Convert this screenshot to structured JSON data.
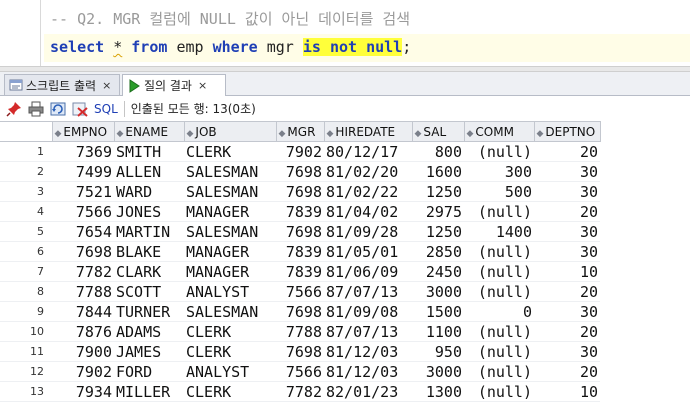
{
  "editor": {
    "comment": "-- Q2. MGR 컬럼에 NULL 값이 아닌 데이터를 검색",
    "sql": {
      "kw_select": "select",
      "star": "*",
      "kw_from": "from",
      "table": "emp",
      "kw_where": "where",
      "column": "mgr",
      "kw_is": "is",
      "kw_not": "not",
      "kw_null": "null",
      "terminator": ";"
    }
  },
  "tabs": [
    {
      "label": "스크립트 출력",
      "close": "×",
      "active": false
    },
    {
      "label": "질의 결과",
      "close": "×",
      "active": true
    }
  ],
  "toolbar": {
    "sql_label": "SQL",
    "status": "인출된 모든 행: 13(0초)"
  },
  "grid": {
    "columns": [
      "EMPNO",
      "ENAME",
      "JOB",
      "MGR",
      "HIREDATE",
      "SAL",
      "COMM",
      "DEPTNO"
    ],
    "rows": [
      [
        "1",
        "7369",
        "SMITH",
        "CLERK",
        "7902",
        "80/12/17",
        "800",
        "(null)",
        "20"
      ],
      [
        "2",
        "7499",
        "ALLEN",
        "SALESMAN",
        "7698",
        "81/02/20",
        "1600",
        "300",
        "30"
      ],
      [
        "3",
        "7521",
        "WARD",
        "SALESMAN",
        "7698",
        "81/02/22",
        "1250",
        "500",
        "30"
      ],
      [
        "4",
        "7566",
        "JONES",
        "MANAGER",
        "7839",
        "81/04/02",
        "2975",
        "(null)",
        "20"
      ],
      [
        "5",
        "7654",
        "MARTIN",
        "SALESMAN",
        "7698",
        "81/09/28",
        "1250",
        "1400",
        "30"
      ],
      [
        "6",
        "7698",
        "BLAKE",
        "MANAGER",
        "7839",
        "81/05/01",
        "2850",
        "(null)",
        "30"
      ],
      [
        "7",
        "7782",
        "CLARK",
        "MANAGER",
        "7839",
        "81/06/09",
        "2450",
        "(null)",
        "10"
      ],
      [
        "8",
        "7788",
        "SCOTT",
        "ANALYST",
        "7566",
        "87/07/13",
        "3000",
        "(null)",
        "20"
      ],
      [
        "9",
        "7844",
        "TURNER",
        "SALESMAN",
        "7698",
        "81/09/08",
        "1500",
        "0",
        "30"
      ],
      [
        "10",
        "7876",
        "ADAMS",
        "CLERK",
        "7788",
        "87/07/13",
        "1100",
        "(null)",
        "20"
      ],
      [
        "11",
        "7900",
        "JAMES",
        "CLERK",
        "7698",
        "81/12/03",
        "950",
        "(null)",
        "30"
      ],
      [
        "12",
        "7902",
        "FORD",
        "ANALYST",
        "7566",
        "81/12/03",
        "3000",
        "(null)",
        "20"
      ],
      [
        "13",
        "7934",
        "MILLER",
        "CLERK",
        "7782",
        "82/01/23",
        "1300",
        "(null)",
        "10"
      ]
    ]
  },
  "colors": {
    "keyword": "#1f3fb5",
    "highlight": "#ffff3a",
    "comment": "#9a9a9a"
  }
}
